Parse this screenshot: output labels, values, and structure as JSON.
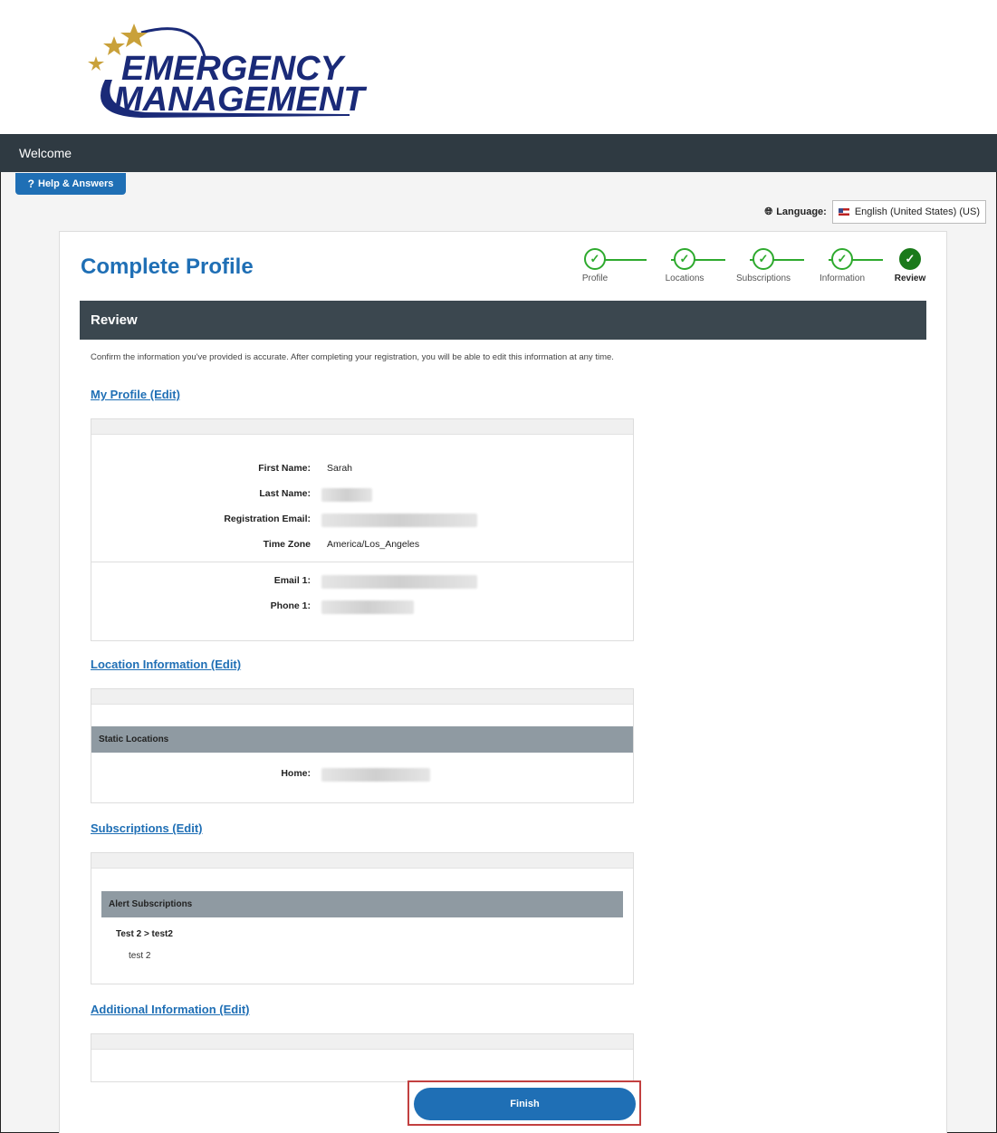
{
  "logo": {
    "line1": "EMERGENCY",
    "line2": "MANAGEMENT"
  },
  "welcome": "Welcome",
  "help_button": "Help & Answers",
  "language": {
    "label": "Language:",
    "selected": "English (United States) (US)"
  },
  "page_title": "Complete Profile",
  "steps": [
    {
      "label": "Profile",
      "state": "done"
    },
    {
      "label": "Locations",
      "state": "done"
    },
    {
      "label": "Subscriptions",
      "state": "done"
    },
    {
      "label": "Information",
      "state": "done"
    },
    {
      "label": "Review",
      "state": "active"
    }
  ],
  "review_header": "Review",
  "confirm_text": "Confirm the information you've provided is accurate. After completing your registration, you will be able to edit this information at any time.",
  "my_profile": {
    "link": "My Profile (Edit)",
    "fields": [
      {
        "label": "First Name:",
        "value": "Sarah"
      },
      {
        "label": "Last Name:",
        "value": ""
      },
      {
        "label": "Registration Email:",
        "value": ""
      },
      {
        "label": "Time Zone",
        "value": "America/Los_Angeles"
      },
      {
        "label": "Email 1:",
        "value": ""
      },
      {
        "label": "Phone 1:",
        "value": ""
      }
    ]
  },
  "location_info": {
    "link": "Location Information (Edit)",
    "group_header": "Static Locations",
    "home_label": "Home:"
  },
  "subscriptions": {
    "link": "Subscriptions (Edit)",
    "group_header": "Alert Subscriptions",
    "item_title": "Test 2 > test2",
    "item_sub": "test 2"
  },
  "additional_info": {
    "link": "Additional Information (Edit)"
  },
  "finish_button": "Finish",
  "colors": {
    "primary": "#1f6fb5",
    "dark_bar": "#2f3a42",
    "step_green": "#2eaa2e",
    "highlight_outline": "#c24040"
  }
}
